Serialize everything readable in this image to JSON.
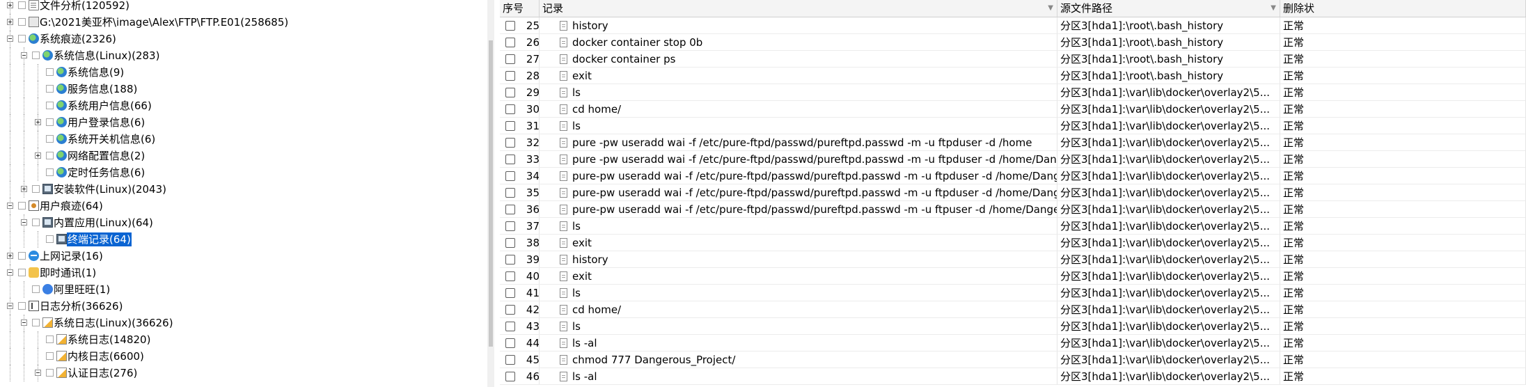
{
  "tree": {
    "nodes": [
      {
        "label": "文件分析(120592)",
        "level": 1,
        "expander": "plus",
        "icon": "doc-icon",
        "selected": false
      },
      {
        "label": "G:\\2021美亚杯\\image\\Alex\\FTP\\FTP.E01(258685)",
        "level": 1,
        "expander": "plus",
        "icon": "drive-icon",
        "selected": false
      },
      {
        "label": "系统痕迹(2326)",
        "level": 1,
        "expander": "minus",
        "icon": "globe-icon",
        "selected": false
      },
      {
        "label": "系统信息(Linux)(283)",
        "level": 2,
        "expander": "minus",
        "icon": "globe-icon",
        "selected": false
      },
      {
        "label": "系统信息(9)",
        "level": 3,
        "expander": "none",
        "icon": "globe-icon",
        "selected": false
      },
      {
        "label": "服务信息(188)",
        "level": 3,
        "expander": "none",
        "icon": "globe-icon",
        "selected": false
      },
      {
        "label": "系统用户信息(66)",
        "level": 3,
        "expander": "none",
        "icon": "globe-icon",
        "selected": false
      },
      {
        "label": "用户登录信息(6)",
        "level": 3,
        "expander": "plus",
        "icon": "globe-icon",
        "selected": false
      },
      {
        "label": "系统开关机信息(6)",
        "level": 3,
        "expander": "none",
        "icon": "globe-icon",
        "selected": false
      },
      {
        "label": "网络配置信息(2)",
        "level": 3,
        "expander": "plus",
        "icon": "globe-icon",
        "selected": false
      },
      {
        "label": "定时任务信息(6)",
        "level": 3,
        "expander": "none",
        "icon": "globe-icon",
        "selected": false
      },
      {
        "label": "安装软件(Linux)(2043)",
        "level": 2,
        "expander": "plus",
        "icon": "app-icon",
        "selected": false
      },
      {
        "label": "用户痕迹(64)",
        "level": 1,
        "expander": "minus",
        "icon": "user-trace-icon",
        "selected": false
      },
      {
        "label": "内置应用(Linux)(64)",
        "level": 2,
        "expander": "minus",
        "icon": "app-icon",
        "selected": false
      },
      {
        "label": "终端记录(64)",
        "level": 3,
        "expander": "none",
        "icon": "app-icon",
        "selected": true
      },
      {
        "label": "上网记录(16)",
        "level": 1,
        "expander": "plus",
        "icon": "ie-icon",
        "selected": false
      },
      {
        "label": "即时通讯(1)",
        "level": 1,
        "expander": "minus",
        "icon": "chat-icon",
        "selected": false
      },
      {
        "label": "阿里旺旺(1)",
        "level": 2,
        "expander": "none",
        "icon": "wangwang-icon",
        "selected": false
      },
      {
        "label": "日志分析(36626)",
        "level": 1,
        "expander": "minus",
        "icon": "log-icon",
        "selected": false
      },
      {
        "label": "系统日志(Linux)(36626)",
        "level": 2,
        "expander": "minus",
        "icon": "warning-doc-icon",
        "selected": false
      },
      {
        "label": "系统日志(14820)",
        "level": 3,
        "expander": "none",
        "icon": "warning-doc-icon",
        "selected": false
      },
      {
        "label": "内核日志(6600)",
        "level": 3,
        "expander": "none",
        "icon": "warning-doc-icon",
        "selected": false
      },
      {
        "label": "认证日志(276)",
        "level": 3,
        "expander": "minus",
        "icon": "warning-doc-icon",
        "selected": false
      }
    ]
  },
  "table": {
    "headers": {
      "seq": "序号",
      "record": "记录",
      "path": "源文件路径",
      "status": "删除状"
    },
    "rows": [
      {
        "seq": "25",
        "record": "history",
        "path": "分区3[hda1]:\\root\\.bash_history",
        "status": "正常"
      },
      {
        "seq": "26",
        "record": "docker container stop 0b",
        "path": "分区3[hda1]:\\root\\.bash_history",
        "status": "正常"
      },
      {
        "seq": "27",
        "record": "docker container ps",
        "path": "分区3[hda1]:\\root\\.bash_history",
        "status": "正常"
      },
      {
        "seq": "28",
        "record": "exit",
        "path": "分区3[hda1]:\\root\\.bash_history",
        "status": "正常"
      },
      {
        "seq": "29",
        "record": "ls",
        "path": "分区3[hda1]:\\var\\lib\\docker\\overlay2\\5...",
        "status": "正常"
      },
      {
        "seq": "30",
        "record": "cd home/",
        "path": "分区3[hda1]:\\var\\lib\\docker\\overlay2\\5...",
        "status": "正常"
      },
      {
        "seq": "31",
        "record": "ls",
        "path": "分区3[hda1]:\\var\\lib\\docker\\overlay2\\5...",
        "status": "正常"
      },
      {
        "seq": "32",
        "record": "pure  -pw useradd wai -f /etc/pure-ftpd/passwd/pureftpd.passwd -m -u ftpduser -d /home",
        "path": "分区3[hda1]:\\var\\lib\\docker\\overlay2\\5...",
        "status": "正常"
      },
      {
        "seq": "33",
        "record": "pure  -pw useradd wai -f /etc/pure-ftpd/passwd/pureftpd.passwd -m -u ftpduser -d /home/Dangerous_Project/",
        "path": "分区3[hda1]:\\var\\lib\\docker\\overlay2\\5...",
        "status": "正常"
      },
      {
        "seq": "34",
        "record": "pure-pw useradd wai -f /etc/pure-ftpd/passwd/pureftpd.passwd -m -u ftpduser -d /home/Dangerous_Project/",
        "path": "分区3[hda1]:\\var\\lib\\docker\\overlay2\\5...",
        "status": "正常"
      },
      {
        "seq": "35",
        "record": "pure-pw useradd wai -f /etc/pure-ftpd/passwd/pureftpd.passwd -m -u ftpduser -d /home/Dangerous_Project",
        "path": "分区3[hda1]:\\var\\lib\\docker\\overlay2\\5...",
        "status": "正常"
      },
      {
        "seq": "36",
        "record": "pure-pw useradd wai -f /etc/pure-ftpd/passwd/pureftpd.passwd -m -u ftpuser -d /home/Dangerous_Project",
        "path": "分区3[hda1]:\\var\\lib\\docker\\overlay2\\5...",
        "status": "正常"
      },
      {
        "seq": "37",
        "record": "ls",
        "path": "分区3[hda1]:\\var\\lib\\docker\\overlay2\\5...",
        "status": "正常"
      },
      {
        "seq": "38",
        "record": "exit",
        "path": "分区3[hda1]:\\var\\lib\\docker\\overlay2\\5...",
        "status": "正常"
      },
      {
        "seq": "39",
        "record": "history",
        "path": "分区3[hda1]:\\var\\lib\\docker\\overlay2\\5...",
        "status": "正常"
      },
      {
        "seq": "40",
        "record": "exit",
        "path": "分区3[hda1]:\\var\\lib\\docker\\overlay2\\5...",
        "status": "正常"
      },
      {
        "seq": "41",
        "record": "ls",
        "path": "分区3[hda1]:\\var\\lib\\docker\\overlay2\\5...",
        "status": "正常"
      },
      {
        "seq": "42",
        "record": "cd home/",
        "path": "分区3[hda1]:\\var\\lib\\docker\\overlay2\\5...",
        "status": "正常"
      },
      {
        "seq": "43",
        "record": "ls",
        "path": "分区3[hda1]:\\var\\lib\\docker\\overlay2\\5...",
        "status": "正常"
      },
      {
        "seq": "44",
        "record": "ls -al",
        "path": "分区3[hda1]:\\var\\lib\\docker\\overlay2\\5...",
        "status": "正常"
      },
      {
        "seq": "45",
        "record": "chmod 777 Dangerous_Project/",
        "path": "分区3[hda1]:\\var\\lib\\docker\\overlay2\\5...",
        "status": "正常"
      },
      {
        "seq": "46",
        "record": "ls -al",
        "path": "分区3[hda1]:\\var\\lib\\docker\\overlay2\\5...",
        "status": "正常"
      }
    ]
  }
}
